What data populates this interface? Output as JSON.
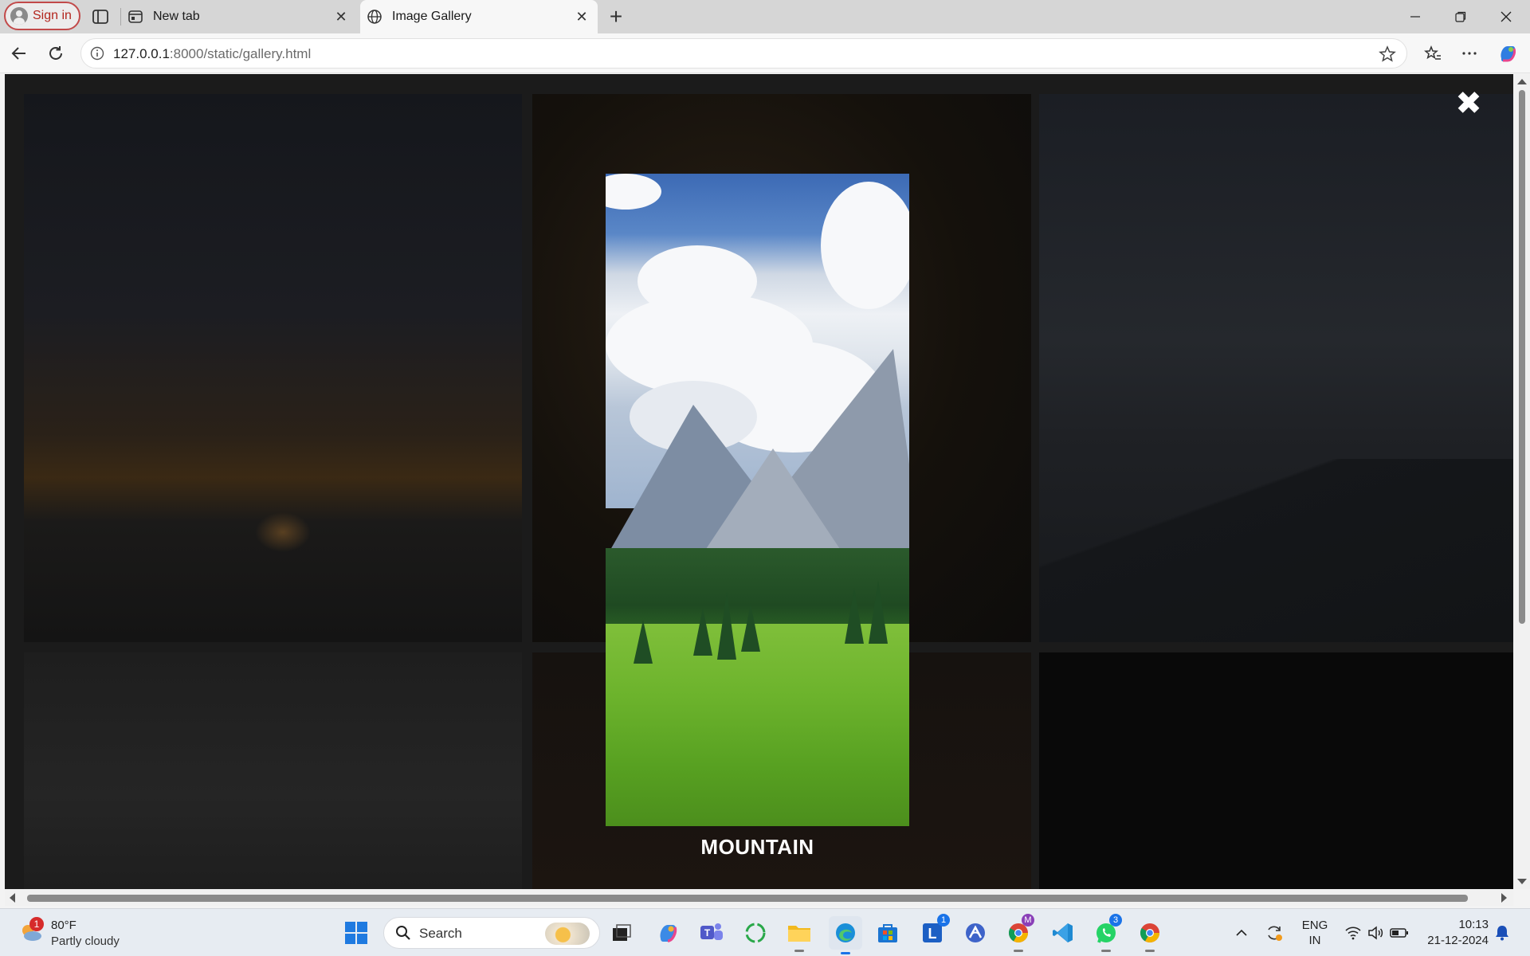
{
  "browser": {
    "signin_label": "Sign in",
    "tabs": [
      {
        "title": "New tab",
        "active": false
      },
      {
        "title": "Image Gallery",
        "active": true
      }
    ],
    "url_host": "127.0.0.1",
    "url_rest": ":8000/static/gallery.html"
  },
  "gallery": {
    "modal_caption": "MOUNTAIN",
    "close_symbol": "✖"
  },
  "taskbar": {
    "weather_temp": "80°F",
    "weather_condition": "Partly cloudy",
    "weather_badge": "1",
    "search_placeholder": "Search",
    "language_line1": "ENG",
    "language_line2": "IN",
    "time": "10:13",
    "date": "21-12-2024",
    "badges": {
      "l_app": "1",
      "edge_profile": "M",
      "whatsapp": "3"
    }
  },
  "icons": [
    "user-icon",
    "tab-actions-icon",
    "new-tab-page-icon",
    "globe-icon",
    "close-icon",
    "plus-icon",
    "minimize-icon",
    "restore-icon",
    "back-icon",
    "reload-icon",
    "info-icon",
    "star-icon",
    "favorites-icon",
    "more-icon",
    "copilot-icon",
    "windows-icon",
    "search-icon",
    "task-view-icon",
    "teams-icon",
    "folder-icon",
    "edge-icon",
    "store-icon",
    "vscode-icon",
    "whatsapp-icon",
    "chrome-icon",
    "wifi-icon",
    "volume-icon",
    "battery-icon",
    "bell-icon"
  ]
}
